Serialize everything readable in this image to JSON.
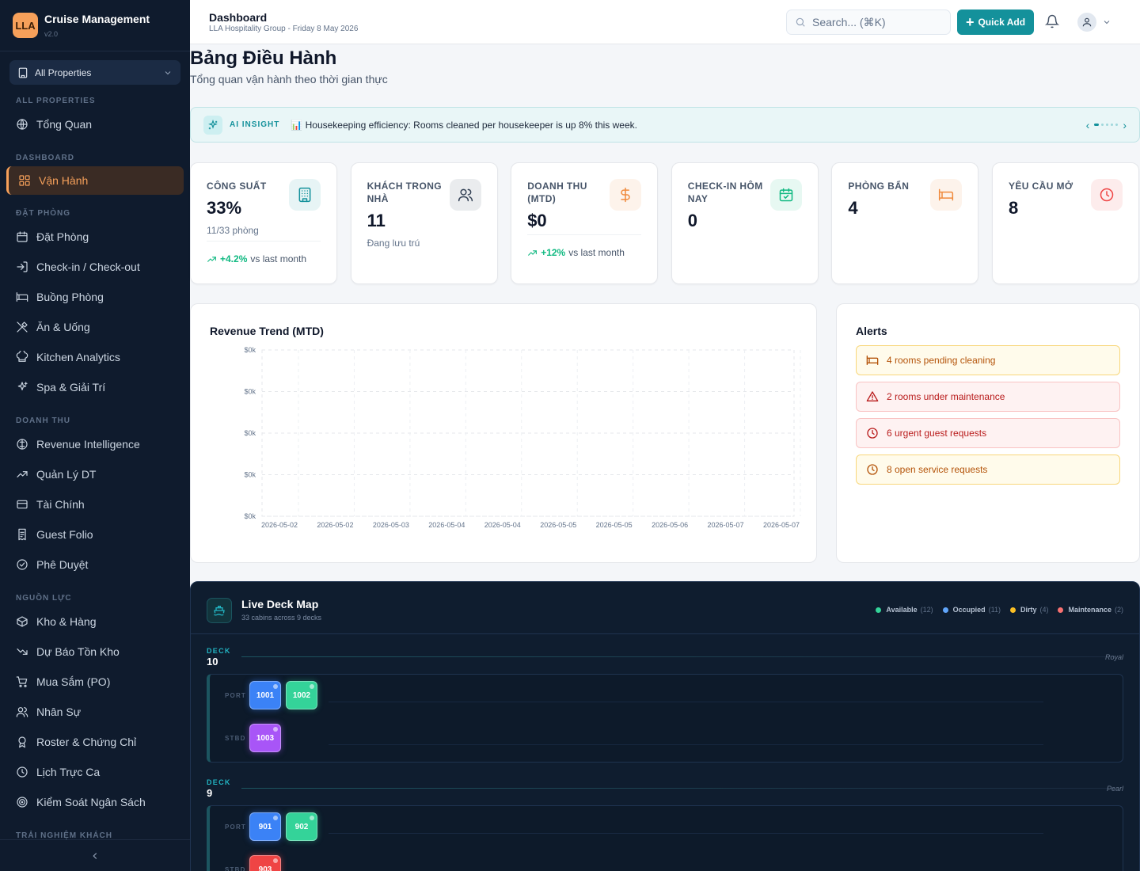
{
  "brand": {
    "logo": "LLA",
    "name": "Cruise Management",
    "version": "v2.0"
  },
  "property_selector": {
    "label": "All Properties"
  },
  "sidebar": {
    "sections": [
      {
        "title": "ALL PROPERTIES",
        "items": [
          {
            "label": "Tổng Quan",
            "icon": "globe-icon"
          }
        ]
      },
      {
        "title": "DASHBOARD",
        "items": [
          {
            "label": "Vận Hành",
            "icon": "grid-icon",
            "active": true
          }
        ]
      },
      {
        "title": "ĐẶT PHÒNG",
        "items": [
          {
            "label": "Đặt Phòng",
            "icon": "calendar-icon"
          },
          {
            "label": "Check-in / Check-out",
            "icon": "login-icon"
          },
          {
            "label": "Buồng Phòng",
            "icon": "bed-icon"
          },
          {
            "label": "Ăn & Uống",
            "icon": "utensils-icon"
          },
          {
            "label": "Kitchen Analytics",
            "icon": "chef-hat-icon"
          },
          {
            "label": "Spa & Giải Trí",
            "icon": "sparkles-icon"
          }
        ]
      },
      {
        "title": "DOANH THU",
        "items": [
          {
            "label": "Revenue Intelligence",
            "icon": "brain-icon"
          },
          {
            "label": "Quản Lý DT",
            "icon": "trend-up-icon"
          },
          {
            "label": "Tài Chính",
            "icon": "wallet-icon"
          },
          {
            "label": "Guest Folio",
            "icon": "receipt-icon"
          },
          {
            "label": "Phê Duyệt",
            "icon": "check-circle-icon"
          }
        ]
      },
      {
        "title": "NGUỒN LỰC",
        "items": [
          {
            "label": "Kho & Hàng",
            "icon": "package-icon"
          },
          {
            "label": "Dự Báo Tồn Kho",
            "icon": "trend-down-icon"
          },
          {
            "label": "Mua Sắm (PO)",
            "icon": "cart-icon"
          },
          {
            "label": "Nhân Sự",
            "icon": "users-icon"
          },
          {
            "label": "Roster & Chứng Chỉ",
            "icon": "award-icon"
          },
          {
            "label": "Lịch Trực Ca",
            "icon": "clock-icon"
          },
          {
            "label": "Kiểm Soát Ngân Sách",
            "icon": "target-icon"
          }
        ]
      },
      {
        "title": "TRẢI NGHIỆM KHÁCH",
        "items": []
      }
    ]
  },
  "header": {
    "title": "Dashboard",
    "subtitle": "LLA Hospitality Group - Friday 8 May 2026",
    "search_placeholder": "Search... (⌘K)",
    "quick_add": "Quick Add"
  },
  "page": {
    "title": "Bảng Điều Hành",
    "subtitle": "Tổng quan vận hành theo thời gian thực"
  },
  "insight": {
    "tag": "AI INSIGHT",
    "text": "📊 Housekeeping efficiency: Rooms cleaned per housekeeper is up 8% this week.",
    "active_dot": 0,
    "dot_count": 5
  },
  "kpis": [
    {
      "label": "CÔNG SUẤT",
      "value": "33%",
      "sub": "11/33 phòng",
      "trend_value": "+4.2%",
      "trend_text": "vs last month",
      "icon": "building-icon",
      "color": "#14919b"
    },
    {
      "label": "KHÁCH TRONG NHÀ",
      "value": "11",
      "sub": "Đang lưu trú",
      "icon": "users-icon",
      "color": "#334155"
    },
    {
      "label": "DOANH THU (MTD)",
      "value": "$0",
      "trend_value": "+12%",
      "trend_text": "vs last month",
      "icon": "dollar-icon",
      "color": "#f08a3c"
    },
    {
      "label": "CHECK-IN HÔM NAY",
      "value": "0",
      "icon": "calendar-check-icon",
      "color": "#10b981"
    },
    {
      "label": "PHÒNG BẨN",
      "value": "4",
      "icon": "bed-icon",
      "color": "#f08a3c"
    },
    {
      "label": "YÊU CẦU MỞ",
      "value": "8",
      "icon": "clock-icon",
      "color": "#ef4444"
    }
  ],
  "chart_data": {
    "type": "line",
    "title": "Revenue Trend (MTD)",
    "x": [
      "2026-05-02",
      "2026-05-02",
      "2026-05-03",
      "2026-05-04",
      "2026-05-04",
      "2026-05-05",
      "2026-05-05",
      "2026-05-06",
      "2026-05-07",
      "2026-05-07"
    ],
    "series": [
      {
        "values": [
          0,
          0,
          0,
          0,
          0,
          0,
          0,
          0,
          0,
          0
        ]
      }
    ],
    "y_ticks": [
      "$0k",
      "$0k",
      "$0k",
      "$0k",
      "$0k"
    ],
    "grid": true,
    "xlabel": "",
    "ylabel": ""
  },
  "alerts": {
    "title": "Alerts",
    "items": [
      {
        "text": "4 rooms pending cleaning",
        "level": "warn",
        "icon": "bed-icon"
      },
      {
        "text": "2 rooms under maintenance",
        "level": "danger",
        "icon": "warning-icon"
      },
      {
        "text": "6 urgent guest requests",
        "level": "danger",
        "icon": "clock-icon"
      },
      {
        "text": "8 open service requests",
        "level": "warn",
        "icon": "clock-icon"
      }
    ]
  },
  "deck_map": {
    "title": "Live Deck Map",
    "subtitle": "33 cabins across 9 decks",
    "legend": [
      {
        "label": "Available",
        "count": "(12)",
        "color": "#34d399"
      },
      {
        "label": "Occupied",
        "count": "(11)",
        "color": "#60a5fa"
      },
      {
        "label": "Dirty",
        "count": "(4)",
        "color": "#fbbf24"
      },
      {
        "label": "Maintenance",
        "count": "(2)",
        "color": "#f87171"
      }
    ],
    "deck_word": "DECK",
    "port_label": "PORT",
    "stbd_label": "STBD",
    "decks": [
      {
        "number": "10",
        "class": "Royal",
        "port": [
          {
            "no": "1001",
            "status": "occupied"
          },
          {
            "no": "1002",
            "status": "available"
          }
        ],
        "stbd": [
          {
            "no": "1003",
            "status": "purple"
          }
        ]
      },
      {
        "number": "9",
        "class": "Pearl",
        "port": [
          {
            "no": "901",
            "status": "occupied"
          },
          {
            "no": "902",
            "status": "available"
          }
        ],
        "stbd": [
          {
            "no": "903",
            "status": "maintenance"
          }
        ]
      }
    ]
  }
}
